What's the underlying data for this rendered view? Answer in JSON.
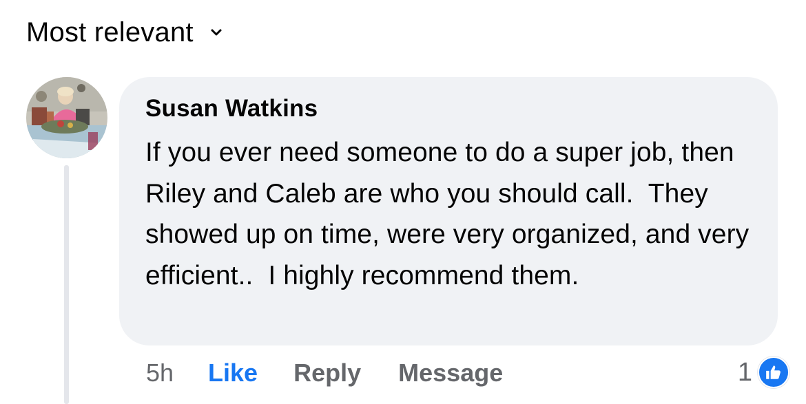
{
  "sort": {
    "label": "Most relevant",
    "icon": "chevron-down-icon"
  },
  "comment": {
    "author": "Susan Watkins",
    "avatar_icon": "profile-photo",
    "text": "If you ever need someone to do a super job, then Riley and Caleb are who you should call.  They showed up on time, were very organized, and very efficient..  I highly recommend them.",
    "time": "5h",
    "actions": {
      "like": "Like",
      "reply": "Reply",
      "message": "Message"
    },
    "reactions": {
      "count": "1",
      "icon": "thumbs-up-icon"
    }
  },
  "colors": {
    "accent": "#1877f2",
    "bubble": "#f0f2f5",
    "secondary_text": "#65676b",
    "thread_line": "#e4e6eb"
  }
}
